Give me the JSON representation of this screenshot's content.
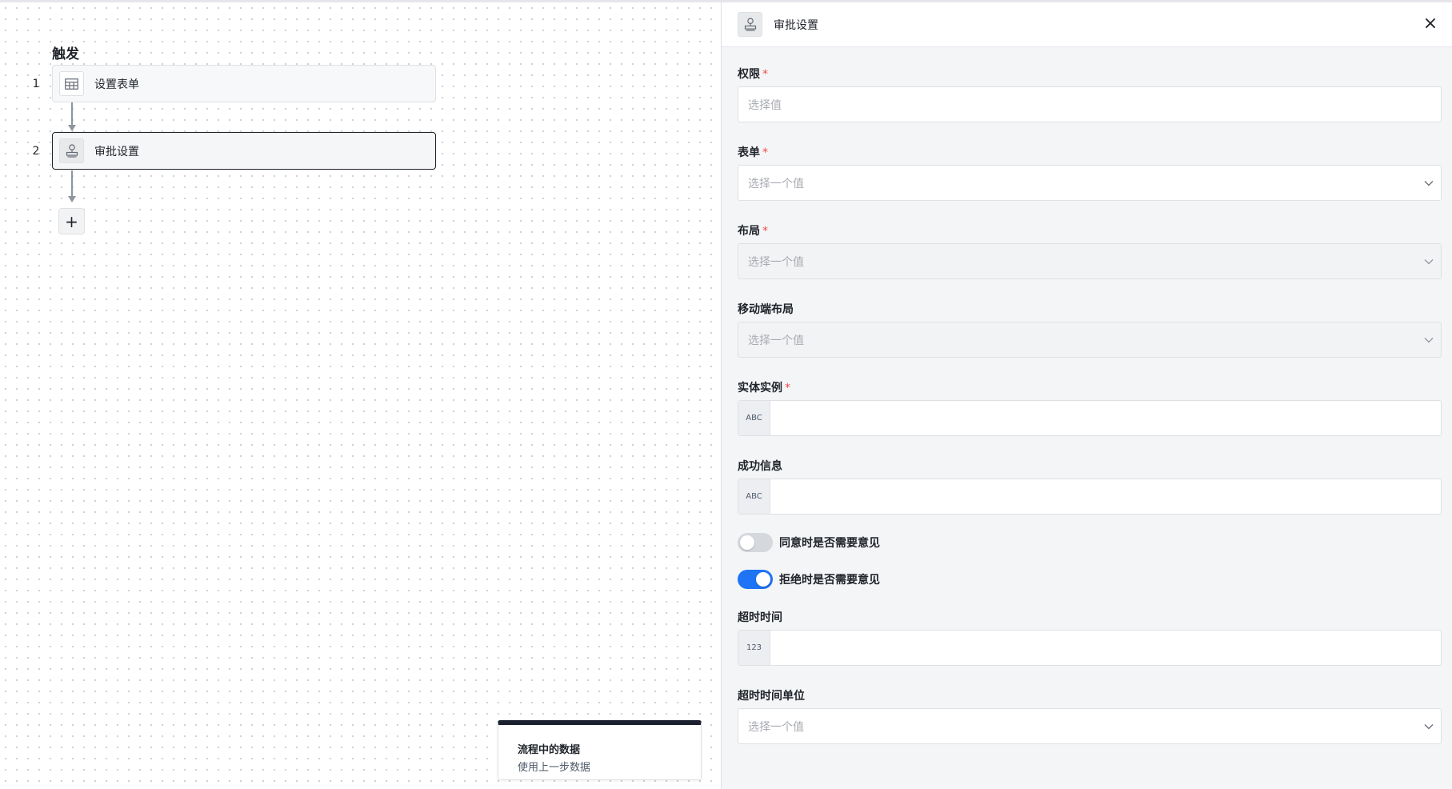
{
  "canvas": {
    "section_title": "触发",
    "steps": [
      {
        "index": "1",
        "label": "设置表单",
        "icon": "table-icon"
      },
      {
        "index": "2",
        "label": "审批设置",
        "icon": "stamp-icon"
      }
    ],
    "add_button": "+",
    "data_card": {
      "title": "流程中的数据",
      "subtitle": "使用上一步数据"
    }
  },
  "panel": {
    "title": "审批设置",
    "icon": "stamp-icon",
    "close": "×",
    "fields": {
      "permission": {
        "label": "权限",
        "required": "*",
        "placeholder": "选择值"
      },
      "form": {
        "label": "表单",
        "required": "*",
        "placeholder": "选择一个值"
      },
      "layout": {
        "label": "布局",
        "required": "*",
        "placeholder": "选择一个值"
      },
      "mobile_layout": {
        "label": "移动端布局",
        "placeholder": "选择一个值"
      },
      "entity_instance": {
        "label": "实体实例",
        "required": "*",
        "prefix": "ABC"
      },
      "success_message": {
        "label": "成功信息",
        "prefix": "ABC"
      },
      "timeout": {
        "label": "超时时间",
        "prefix": "123"
      },
      "timeout_unit": {
        "label": "超时时间单位",
        "placeholder": "选择一个值"
      }
    },
    "switches": {
      "agree_opinion": {
        "label": "同意时是否需要意见",
        "on": false
      },
      "reject_opinion": {
        "label": "拒绝时是否需要意见",
        "on": true
      }
    }
  },
  "colors": {
    "accent": "#1e74f5",
    "required": "#f54a45",
    "card_top_bar": "#1c2130"
  }
}
